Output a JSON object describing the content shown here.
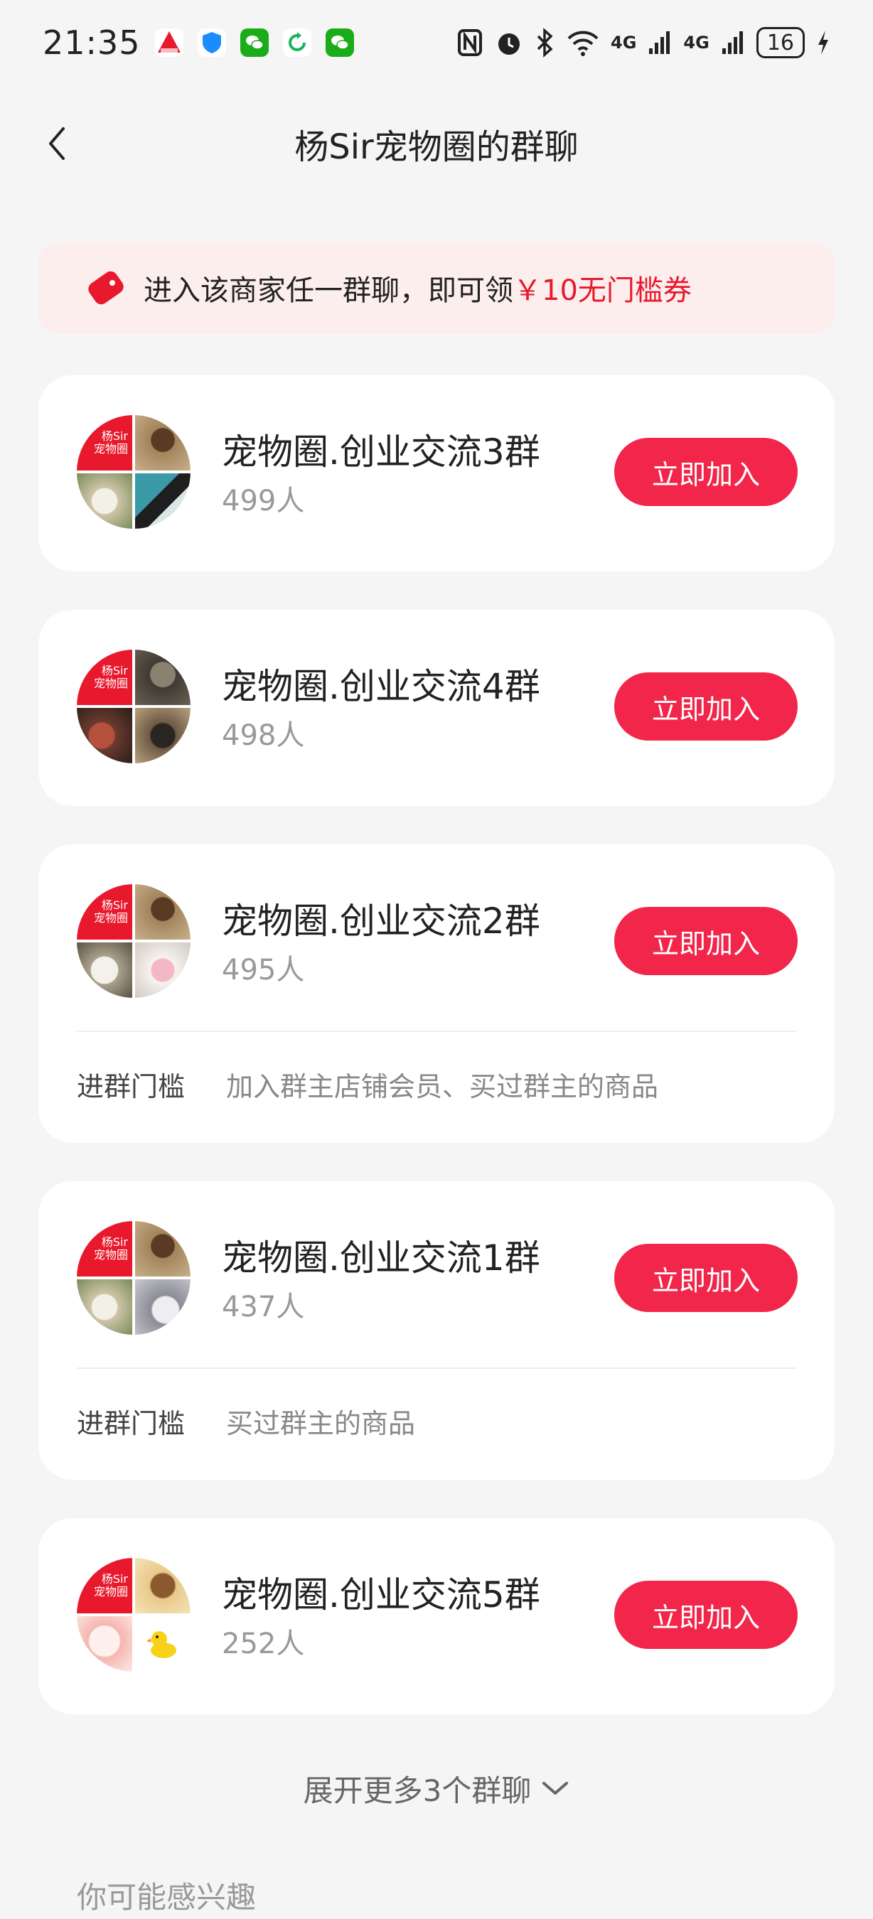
{
  "status_bar": {
    "time": "21:35",
    "network": "4G",
    "battery": "16"
  },
  "header": {
    "title": "杨Sir宠物圈的群聊"
  },
  "coupon": {
    "text": "进入该商家任一群聊，即可领",
    "highlight": "￥10无门槛券",
    "accent_color": "#e8192c"
  },
  "avatar_logo": {
    "line1": "杨Sir",
    "line2": "宠物圈"
  },
  "groups": [
    {
      "name": "宠物圈.创业交流3群",
      "members": "499人",
      "join_label": "立即加入"
    },
    {
      "name": "宠物圈.创业交流4群",
      "members": "498人",
      "join_label": "立即加入"
    },
    {
      "name": "宠物圈.创业交流2群",
      "members": "495人",
      "join_label": "立即加入",
      "threshold_label": "进群门槛",
      "threshold": "加入群主店铺会员、买过群主的商品"
    },
    {
      "name": "宠物圈.创业交流1群",
      "members": "437人",
      "join_label": "立即加入",
      "threshold_label": "进群门槛",
      "threshold": "买过群主的商品"
    },
    {
      "name": "宠物圈.创业交流5群",
      "members": "252人",
      "join_label": "立即加入"
    }
  ],
  "expand": {
    "label": "展开更多3个群聊"
  },
  "recommend": {
    "title": "你可能感兴趣"
  },
  "colors": {
    "button": "#f2264a",
    "banner_bg": "#fdeeee",
    "page_bg": "#f5f5f5"
  }
}
